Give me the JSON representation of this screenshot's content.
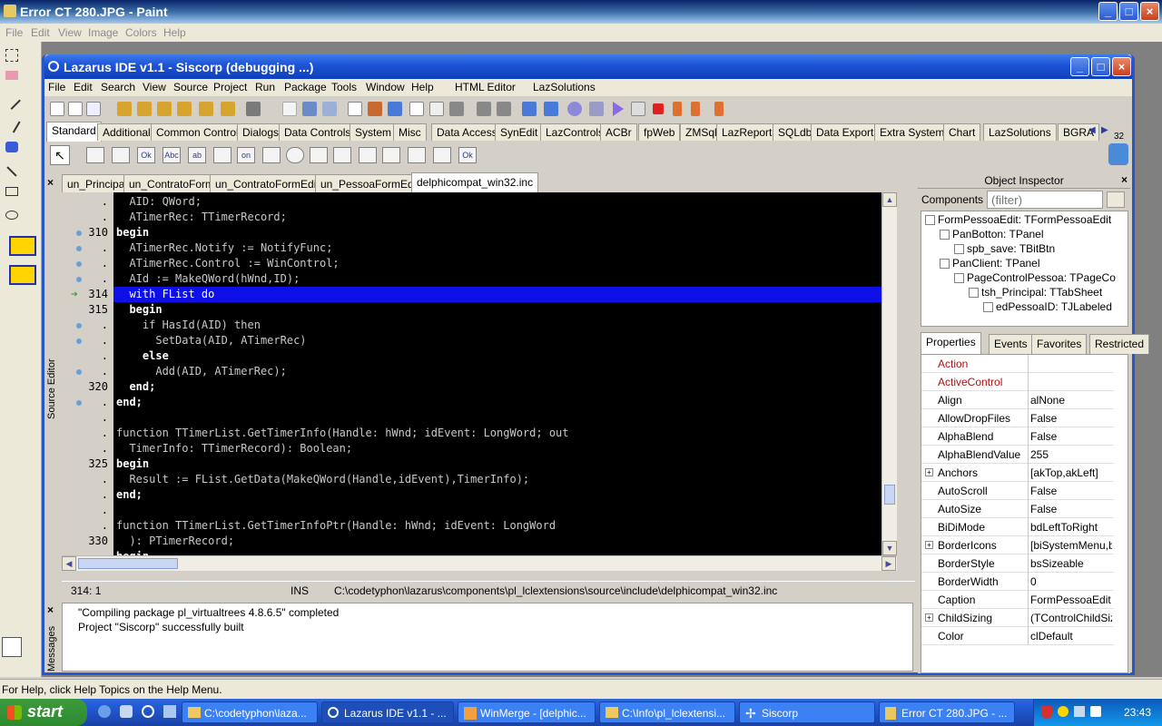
{
  "paint": {
    "title": "Error CT 280.JPG - Paint",
    "menu": [
      "File",
      "Edit",
      "View",
      "Image",
      "Colors",
      "Help"
    ],
    "status": "For Help, click Help Topics on the Help Menu."
  },
  "lazarus": {
    "title": "Lazarus IDE v1.1 - Siscorp (debugging ...)",
    "menu": [
      "File",
      "Edit",
      "Search",
      "View",
      "Source",
      "Project",
      "Run",
      "Package",
      "Tools",
      "Window",
      "Help",
      "HTML Editor",
      "LazSolutions"
    ],
    "palette_tabs": [
      "Standard",
      "Additional",
      "Common Controls",
      "Dialogs",
      "Data Controls",
      "System",
      "Misc",
      "Data Access",
      "SynEdit",
      "LazControls",
      "ACBr",
      "fpWeb",
      "ZMSql",
      "LazReport",
      "SQLdb",
      "Data Export",
      "Extra System",
      "Chart",
      "LazSolutions",
      "BGRA"
    ],
    "palette_active": "Standard",
    "palette_counter": "32",
    "component_icons": [
      "",
      "",
      "Ok",
      "Abc",
      "ab",
      "",
      "on",
      "",
      "",
      "",
      "",
      "",
      "",
      "",
      "",
      "Ok"
    ]
  },
  "editor": {
    "side_label": "Source Editor",
    "tabs": [
      "un_Principal",
      "un_ContratoForm",
      "un_ContratoFormEdit",
      "un_PessoaFormEdit",
      "delphicompat_win32.inc"
    ],
    "active_tab": "delphicompat_win32.inc",
    "gutter": [
      {
        "num": ".",
        "dot": false
      },
      {
        "num": ".",
        "dot": false
      },
      {
        "num": "310",
        "dot": true
      },
      {
        "num": ".",
        "dot": true
      },
      {
        "num": ".",
        "dot": true
      },
      {
        "num": ".",
        "dot": true
      },
      {
        "num": "314",
        "dot": false,
        "arrow": true
      },
      {
        "num": "315",
        "dot": false
      },
      {
        "num": ".",
        "dot": true
      },
      {
        "num": ".",
        "dot": true
      },
      {
        "num": ".",
        "dot": false
      },
      {
        "num": ".",
        "dot": true
      },
      {
        "num": "320",
        "dot": false
      },
      {
        "num": ".",
        "dot": true
      },
      {
        "num": ".",
        "dot": false
      },
      {
        "num": ".",
        "dot": false
      },
      {
        "num": ".",
        "dot": false
      },
      {
        "num": "325",
        "dot": false
      },
      {
        "num": ".",
        "dot": false
      },
      {
        "num": ".",
        "dot": false
      },
      {
        "num": ".",
        "dot": false
      },
      {
        "num": ".",
        "dot": false
      },
      {
        "num": "330",
        "dot": false
      },
      {
        "num": ".",
        "dot": false
      }
    ],
    "code_lines": [
      {
        "text": "  AID: QWord;",
        "hl": false
      },
      {
        "text": "  ATimerRec: TTimerRecord;",
        "hl": false
      },
      {
        "text": "begin",
        "hl": false,
        "kw": true
      },
      {
        "text": "  ATimerRec.Notify := NotifyFunc;",
        "hl": false
      },
      {
        "text": "  ATimerRec.Control := WinControl;",
        "hl": false
      },
      {
        "text": "  AId := MakeQWord(hWnd,ID);",
        "hl": false
      },
      {
        "text": "  with FList do",
        "hl": true
      },
      {
        "text": "  begin",
        "hl": false,
        "kw": true
      },
      {
        "text": "    if HasId(AID) then",
        "hl": false
      },
      {
        "text": "      SetData(AID, ATimerRec)",
        "hl": false
      },
      {
        "text": "    else",
        "hl": false,
        "kw": true
      },
      {
        "text": "      Add(AID, ATimerRec);",
        "hl": false
      },
      {
        "text": "  end;",
        "hl": false,
        "kw": true
      },
      {
        "text": "end;",
        "hl": false,
        "kw": true
      },
      {
        "text": "",
        "hl": false
      },
      {
        "text": "function TTimerList.GetTimerInfo(Handle: hWnd; idEvent: LongWord; out",
        "hl": false
      },
      {
        "text": "  TimerInfo: TTimerRecord): Boolean;",
        "hl": false
      },
      {
        "text": "begin",
        "hl": false,
        "kw": true
      },
      {
        "text": "  Result := FList.GetData(MakeQWord(Handle,idEvent),TimerInfo);",
        "hl": false
      },
      {
        "text": "end;",
        "hl": false,
        "kw": true
      },
      {
        "text": "",
        "hl": false
      },
      {
        "text": "function TTimerList.GetTimerInfoPtr(Handle: hWnd; idEvent: LongWord",
        "hl": false
      },
      {
        "text": "  ): PTimerRecord;",
        "hl": false
      },
      {
        "text": "begin",
        "hl": false,
        "kw": true
      }
    ],
    "status": {
      "position": "314:   1",
      "mode": "INS",
      "path": "C:\\codetyphon\\lazarus\\components\\pl_lclextensions\\source\\include\\delphicompat_win32.inc"
    }
  },
  "messages": {
    "side_label": "Messages",
    "lines": [
      "\"Compiling package pl_virtualtrees 4.8.6.5\" completed",
      "Project \"Siscorp\" successfully built"
    ]
  },
  "object_inspector": {
    "title": "Object Inspector",
    "components_label": "Components",
    "filter_placeholder": "(filter)",
    "tree": [
      {
        "label": "FormPessoaEdit: TFormPessoaEdit",
        "level": 0
      },
      {
        "label": "PanBotton: TPanel",
        "level": 1
      },
      {
        "label": "spb_save: TBitBtn",
        "level": 2
      },
      {
        "label": "PanClient: TPanel",
        "level": 1
      },
      {
        "label": "PageControlPessoa: TPageCo",
        "level": 2
      },
      {
        "label": "tsh_Principal: TTabSheet",
        "level": 3
      },
      {
        "label": "edPessoaID: TJLabeled",
        "level": 4
      }
    ],
    "tabs": [
      "Properties",
      "Events",
      "Favorites",
      "Restricted"
    ],
    "active_tab": "Properties",
    "properties": [
      {
        "name": "Action",
        "value": "",
        "red": true
      },
      {
        "name": "ActiveControl",
        "value": "",
        "red": true
      },
      {
        "name": "Align",
        "value": "alNone"
      },
      {
        "name": "AllowDropFiles",
        "value": "False"
      },
      {
        "name": "AlphaBlend",
        "value": "False"
      },
      {
        "name": "AlphaBlendValue",
        "value": "255"
      },
      {
        "name": "Anchors",
        "value": "[akTop,akLeft]",
        "expandable": true
      },
      {
        "name": "AutoScroll",
        "value": "False"
      },
      {
        "name": "AutoSize",
        "value": "False"
      },
      {
        "name": "BiDiMode",
        "value": "bdLeftToRight"
      },
      {
        "name": "BorderIcons",
        "value": "[biSystemMenu,bi",
        "expandable": true
      },
      {
        "name": "BorderStyle",
        "value": "bsSizeable"
      },
      {
        "name": "BorderWidth",
        "value": "0"
      },
      {
        "name": "Caption",
        "value": "FormPessoaEdit"
      },
      {
        "name": "ChildSizing",
        "value": "(TControlChildSizin",
        "expandable": true
      },
      {
        "name": "Color",
        "value": "clDefault"
      }
    ]
  },
  "taskbar": {
    "start": "start",
    "tasks": [
      {
        "label": "C:\\codetyphon\\laza...",
        "active": false
      },
      {
        "label": "Lazarus IDE v1.1 - ...",
        "active": true
      },
      {
        "label": "WinMerge - [delphic...",
        "active": false
      },
      {
        "label": "C:\\Info\\pl_lclextensi...",
        "active": false
      },
      {
        "label": "Siscorp",
        "active": false
      },
      {
        "label": "Error CT 280.JPG - ...",
        "active": false
      }
    ],
    "clock": "23:43"
  },
  "colors": {
    "highlight": "#0f0fe8",
    "xp_blue": "#245edb",
    "editor_bg": "#000000"
  }
}
